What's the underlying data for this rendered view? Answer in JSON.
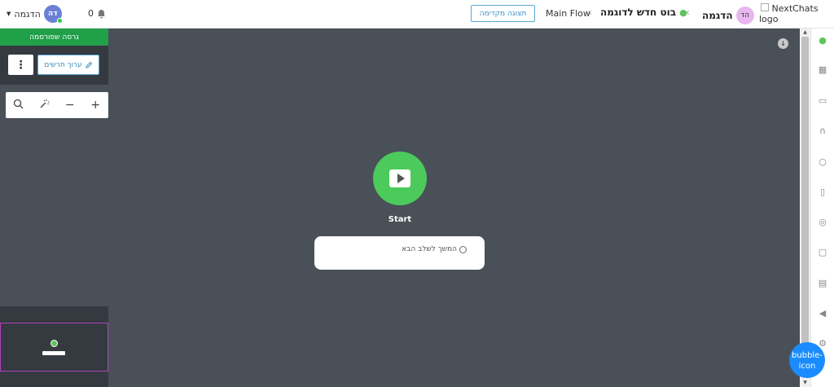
{
  "header": {
    "logo_alt": "NextChats logo",
    "workspace_initials": "הד",
    "workspace_name": "הדגמה",
    "bot_name": "בוט חדש לדוגמה",
    "flow_name": "Main Flow",
    "preview_label": "תצוגה מקדימה",
    "notification_count": "0",
    "user_initials": "דה",
    "user_name": "הדגמה"
  },
  "left_panel": {
    "published_label": "גרסה שפורסמה",
    "edit_draft_label": "ערוך תרשים"
  },
  "canvas": {
    "start_label": "Start",
    "next_step_label": "המשך לשלב הבא"
  },
  "chat_widget": {
    "label": "bubble-icon"
  },
  "colors": {
    "accent": "#3a8fc4",
    "published": "#21a04a",
    "start_node": "#4cca5b",
    "canvas_bg": "#495057",
    "minimap_highlight": "#b23fbf"
  }
}
